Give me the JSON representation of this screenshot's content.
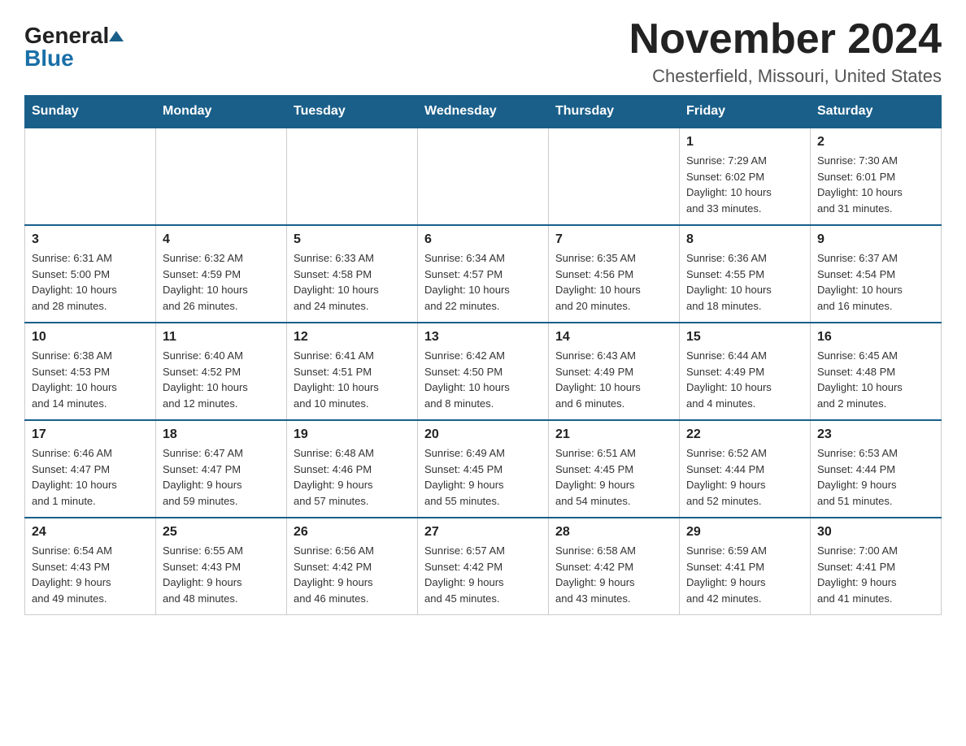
{
  "header": {
    "logo": {
      "general": "General",
      "blue": "Blue"
    },
    "title": "November 2024",
    "subtitle": "Chesterfield, Missouri, United States"
  },
  "weekdays": [
    "Sunday",
    "Monday",
    "Tuesday",
    "Wednesday",
    "Thursday",
    "Friday",
    "Saturday"
  ],
  "weeks": [
    [
      {
        "day": "",
        "info": ""
      },
      {
        "day": "",
        "info": ""
      },
      {
        "day": "",
        "info": ""
      },
      {
        "day": "",
        "info": ""
      },
      {
        "day": "",
        "info": ""
      },
      {
        "day": "1",
        "info": "Sunrise: 7:29 AM\nSunset: 6:02 PM\nDaylight: 10 hours\nand 33 minutes."
      },
      {
        "day": "2",
        "info": "Sunrise: 7:30 AM\nSunset: 6:01 PM\nDaylight: 10 hours\nand 31 minutes."
      }
    ],
    [
      {
        "day": "3",
        "info": "Sunrise: 6:31 AM\nSunset: 5:00 PM\nDaylight: 10 hours\nand 28 minutes."
      },
      {
        "day": "4",
        "info": "Sunrise: 6:32 AM\nSunset: 4:59 PM\nDaylight: 10 hours\nand 26 minutes."
      },
      {
        "day": "5",
        "info": "Sunrise: 6:33 AM\nSunset: 4:58 PM\nDaylight: 10 hours\nand 24 minutes."
      },
      {
        "day": "6",
        "info": "Sunrise: 6:34 AM\nSunset: 4:57 PM\nDaylight: 10 hours\nand 22 minutes."
      },
      {
        "day": "7",
        "info": "Sunrise: 6:35 AM\nSunset: 4:56 PM\nDaylight: 10 hours\nand 20 minutes."
      },
      {
        "day": "8",
        "info": "Sunrise: 6:36 AM\nSunset: 4:55 PM\nDaylight: 10 hours\nand 18 minutes."
      },
      {
        "day": "9",
        "info": "Sunrise: 6:37 AM\nSunset: 4:54 PM\nDaylight: 10 hours\nand 16 minutes."
      }
    ],
    [
      {
        "day": "10",
        "info": "Sunrise: 6:38 AM\nSunset: 4:53 PM\nDaylight: 10 hours\nand 14 minutes."
      },
      {
        "day": "11",
        "info": "Sunrise: 6:40 AM\nSunset: 4:52 PM\nDaylight: 10 hours\nand 12 minutes."
      },
      {
        "day": "12",
        "info": "Sunrise: 6:41 AM\nSunset: 4:51 PM\nDaylight: 10 hours\nand 10 minutes."
      },
      {
        "day": "13",
        "info": "Sunrise: 6:42 AM\nSunset: 4:50 PM\nDaylight: 10 hours\nand 8 minutes."
      },
      {
        "day": "14",
        "info": "Sunrise: 6:43 AM\nSunset: 4:49 PM\nDaylight: 10 hours\nand 6 minutes."
      },
      {
        "day": "15",
        "info": "Sunrise: 6:44 AM\nSunset: 4:49 PM\nDaylight: 10 hours\nand 4 minutes."
      },
      {
        "day": "16",
        "info": "Sunrise: 6:45 AM\nSunset: 4:48 PM\nDaylight: 10 hours\nand 2 minutes."
      }
    ],
    [
      {
        "day": "17",
        "info": "Sunrise: 6:46 AM\nSunset: 4:47 PM\nDaylight: 10 hours\nand 1 minute."
      },
      {
        "day": "18",
        "info": "Sunrise: 6:47 AM\nSunset: 4:47 PM\nDaylight: 9 hours\nand 59 minutes."
      },
      {
        "day": "19",
        "info": "Sunrise: 6:48 AM\nSunset: 4:46 PM\nDaylight: 9 hours\nand 57 minutes."
      },
      {
        "day": "20",
        "info": "Sunrise: 6:49 AM\nSunset: 4:45 PM\nDaylight: 9 hours\nand 55 minutes."
      },
      {
        "day": "21",
        "info": "Sunrise: 6:51 AM\nSunset: 4:45 PM\nDaylight: 9 hours\nand 54 minutes."
      },
      {
        "day": "22",
        "info": "Sunrise: 6:52 AM\nSunset: 4:44 PM\nDaylight: 9 hours\nand 52 minutes."
      },
      {
        "day": "23",
        "info": "Sunrise: 6:53 AM\nSunset: 4:44 PM\nDaylight: 9 hours\nand 51 minutes."
      }
    ],
    [
      {
        "day": "24",
        "info": "Sunrise: 6:54 AM\nSunset: 4:43 PM\nDaylight: 9 hours\nand 49 minutes."
      },
      {
        "day": "25",
        "info": "Sunrise: 6:55 AM\nSunset: 4:43 PM\nDaylight: 9 hours\nand 48 minutes."
      },
      {
        "day": "26",
        "info": "Sunrise: 6:56 AM\nSunset: 4:42 PM\nDaylight: 9 hours\nand 46 minutes."
      },
      {
        "day": "27",
        "info": "Sunrise: 6:57 AM\nSunset: 4:42 PM\nDaylight: 9 hours\nand 45 minutes."
      },
      {
        "day": "28",
        "info": "Sunrise: 6:58 AM\nSunset: 4:42 PM\nDaylight: 9 hours\nand 43 minutes."
      },
      {
        "day": "29",
        "info": "Sunrise: 6:59 AM\nSunset: 4:41 PM\nDaylight: 9 hours\nand 42 minutes."
      },
      {
        "day": "30",
        "info": "Sunrise: 7:00 AM\nSunset: 4:41 PM\nDaylight: 9 hours\nand 41 minutes."
      }
    ]
  ]
}
